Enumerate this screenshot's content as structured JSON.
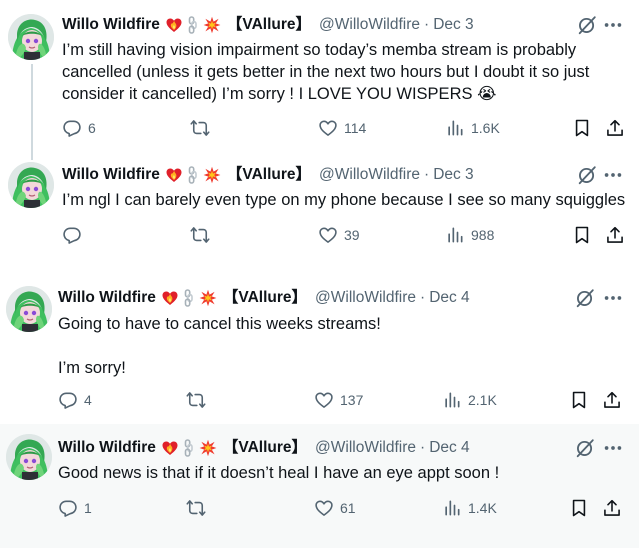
{
  "tweets": [
    {
      "name": "Willo Wildfire",
      "tag": "【VAllure】",
      "handle": "@WilloWildfire",
      "sep": "·",
      "date": "Dec 3",
      "text_lines": [
        "I’m still having vision impairment so today’s memba stream is probably cancelled (unless it gets better in the next two hours but I doubt it so just consider it cancelled) I’m sorry ! I LOVE YOU WISPERS 😭"
      ],
      "replies": "6",
      "reposts": "",
      "likes": "114",
      "views": "1.6K"
    },
    {
      "name": "Willo Wildfire",
      "tag": "【VAllure】",
      "handle": "@WilloWildfire",
      "sep": "·",
      "date": "Dec 3",
      "text_lines": [
        "I’m ngl I can barely even type on my phone because I see so many squiggles"
      ],
      "replies": "",
      "reposts": "",
      "likes": "39",
      "views": "988"
    },
    {
      "name": "Willo Wildfire",
      "tag": "【VAllure】",
      "handle": "@WilloWildfire",
      "sep": "·",
      "date": "Dec 4",
      "text_lines": [
        "Going to have to cancel this weeks streams!",
        "I’m sorry!"
      ],
      "replies": "4",
      "reposts": "",
      "likes": "137",
      "views": "2.1K"
    },
    {
      "name": "Willo Wildfire",
      "tag": "【VAllure】",
      "handle": "@WilloWildfire",
      "sep": "·",
      "date": "Dec 4",
      "text_lines": [
        "Good news is that if it doesn’t heal I have an eye appt soon !"
      ],
      "replies": "1",
      "reposts": "",
      "likes": "61",
      "views": "1.4K"
    }
  ],
  "icons": {
    "avatar": "avatar",
    "emoji_1": "heart-on-fire-emoji",
    "emoji_2": "chains-emoji",
    "emoji_3": "collision-emoji",
    "grok": "grok-icon",
    "more": "more-icon",
    "reply": "reply-icon",
    "repost": "repost-icon",
    "like": "like-icon",
    "views": "views-icon",
    "bookmark": "bookmark-icon",
    "share": "share-icon"
  },
  "colors": {
    "text": "#0f1419",
    "secondary": "#536471",
    "highlight_bg": "#f7f9f9",
    "thread_line": "#cfd9de"
  }
}
